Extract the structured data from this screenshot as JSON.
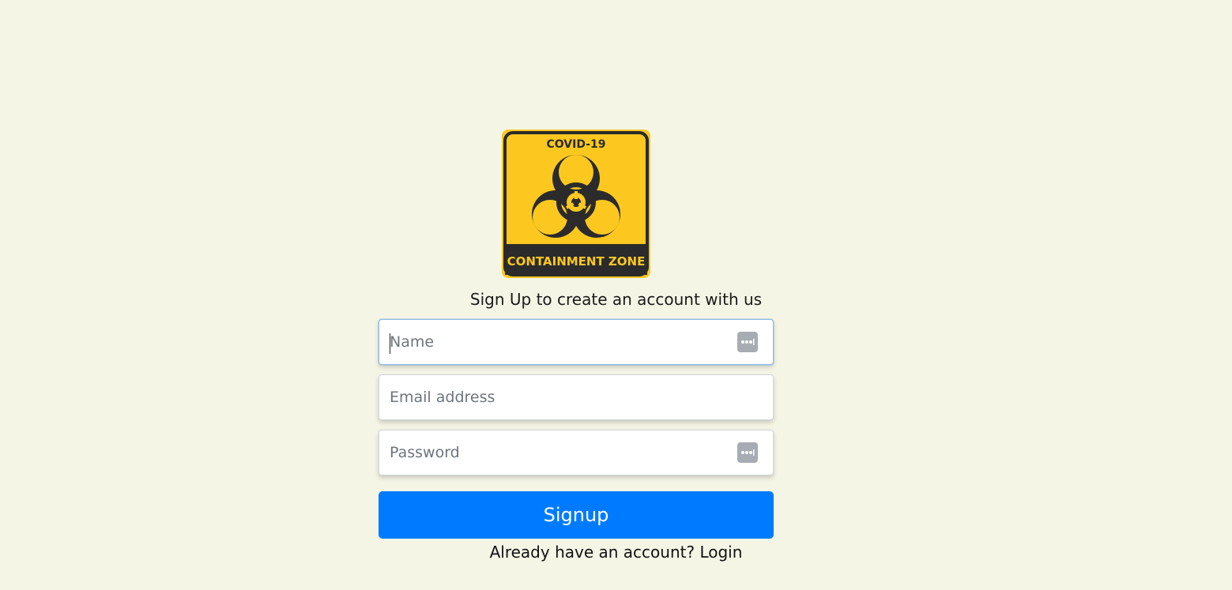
{
  "logo": {
    "top_text": "COVID-19",
    "bottom_text": "CONTAINMENT ZONE",
    "icon": "biohazard-icon",
    "colors": {
      "yellow": "#fcc820",
      "dark": "#2b2b2b"
    }
  },
  "subtitle": "Sign Up to create an account with us",
  "form": {
    "name_placeholder": "Name",
    "email_placeholder": "Email address",
    "password_placeholder": "Password",
    "submit_label": "Signup"
  },
  "footer": {
    "prompt": "Already have an account?",
    "login_label": "Login"
  },
  "colors": {
    "background": "#f5f5e6",
    "primary": "#007bff",
    "password_manager_icon": "#a7acb3"
  }
}
